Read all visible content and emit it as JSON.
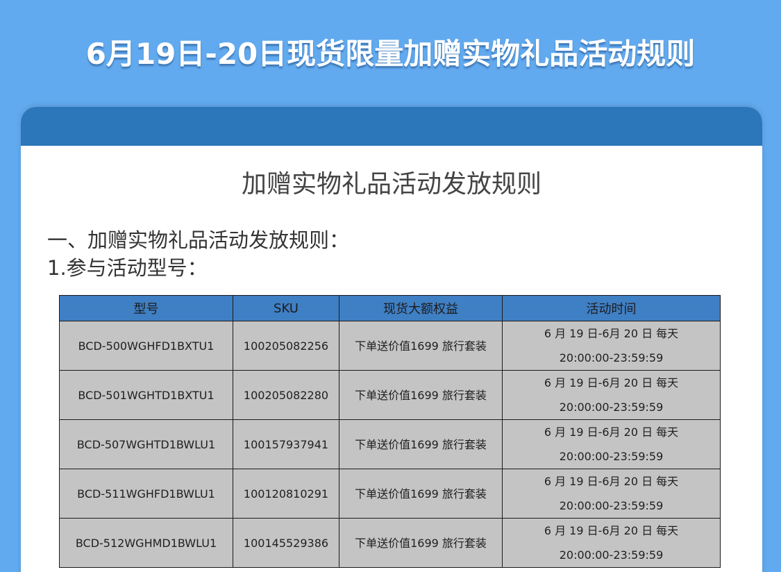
{
  "banner": {
    "title": "6月19日-20日现货限量加赠实物礼品活动规则"
  },
  "card": {
    "title": "加赠实物礼品活动发放规则",
    "section_heading": "一、加赠实物礼品活动发放规则：",
    "subsection_heading": "1.参与活动型号："
  },
  "table": {
    "headers": [
      "型号",
      "SKU",
      "现货大额权益",
      "活动时间"
    ],
    "rows": [
      {
        "model": "BCD-500WGHFD1BXTU1",
        "sku": "100205082256",
        "benefit": "下单送价值1699 旅行套装",
        "time_date": "6 月 19 日-6月 20 日  每天",
        "time_range": "20:00:00-23:59:59"
      },
      {
        "model": "BCD-501WGHTD1BXTU1",
        "sku": "100205082280",
        "benefit": "下单送价值1699 旅行套装",
        "time_date": "6 月 19 日-6月 20 日  每天",
        "time_range": "20:00:00-23:59:59"
      },
      {
        "model": "BCD-507WGHTD1BWLU1",
        "sku": "100157937941",
        "benefit": "下单送价值1699 旅行套装",
        "time_date": "6 月 19 日-6月 20 日  每天",
        "time_range": "20:00:00-23:59:59"
      },
      {
        "model": "BCD-511WGHFD1BWLU1",
        "sku": "100120810291",
        "benefit": "下单送价值1699 旅行套装",
        "time_date": "6 月 19 日-6月 20 日  每天",
        "time_range": "20:00:00-23:59:59"
      },
      {
        "model": "BCD-512WGHMD1BWLU1",
        "sku": "100145529386",
        "benefit": "下单送价值1699 旅行套装",
        "time_date": "6 月 19 日-6月 20 日  每天",
        "time_range": "20:00:00-23:59:59"
      }
    ]
  },
  "colors": {
    "background": "#62aaef",
    "card_header": "#2b77b9",
    "table_header": "#3f7fc4",
    "table_cell": "#c4c4c4"
  }
}
